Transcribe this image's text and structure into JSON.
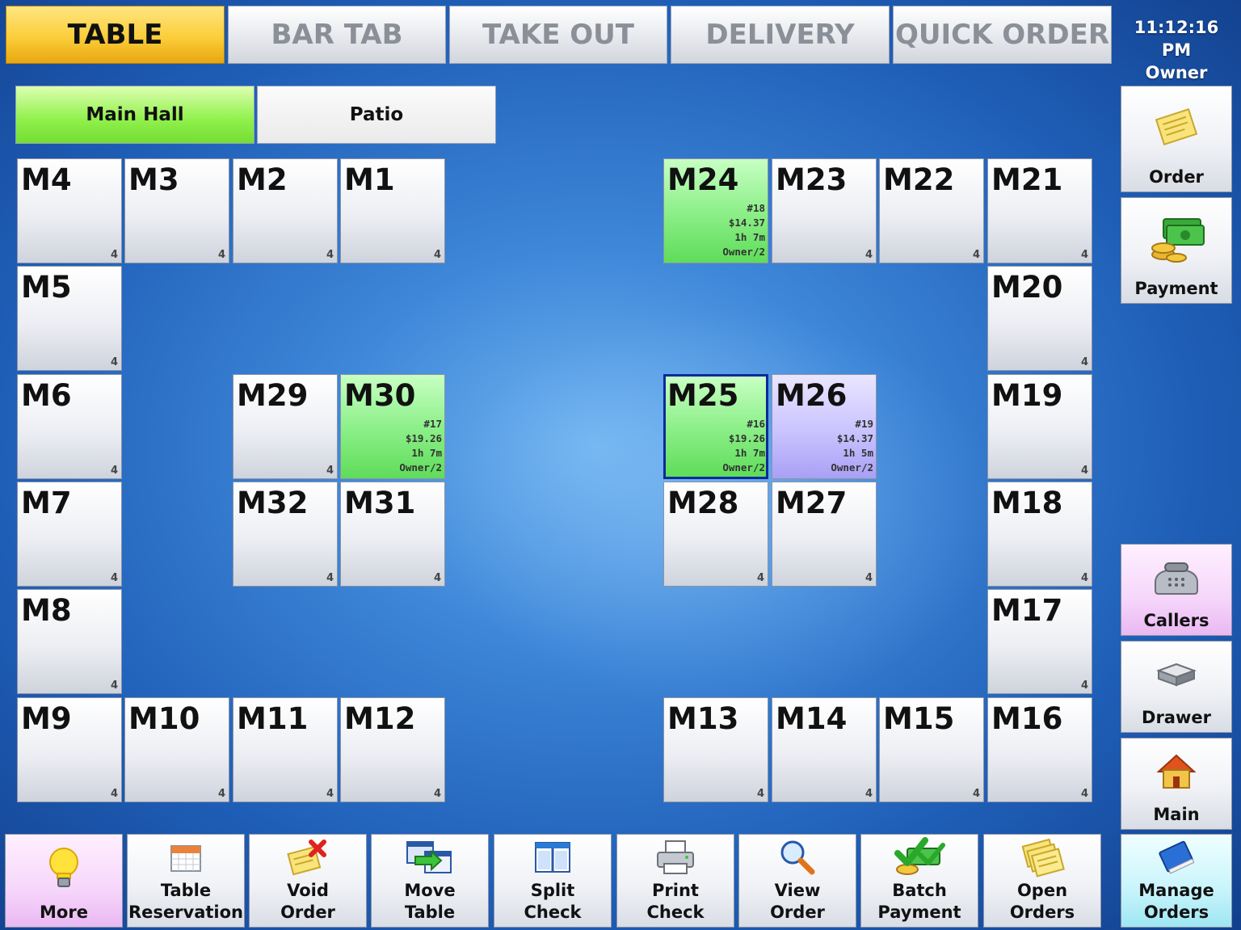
{
  "tabs": [
    "TABLE",
    "BAR TAB",
    "TAKE OUT",
    "DELIVERY",
    "QUICK ORDER"
  ],
  "clock": {
    "time": "11:12:16 PM",
    "user": "Owner"
  },
  "sections": [
    "Main Hall",
    "Patio"
  ],
  "tables": {
    "M1": {
      "name": "M1",
      "seats": "4"
    },
    "M2": {
      "name": "M2",
      "seats": "4"
    },
    "M3": {
      "name": "M3",
      "seats": "4"
    },
    "M4": {
      "name": "M4",
      "seats": "4"
    },
    "M5": {
      "name": "M5",
      "seats": "4"
    },
    "M6": {
      "name": "M6",
      "seats": "4"
    },
    "M7": {
      "name": "M7",
      "seats": "4"
    },
    "M8": {
      "name": "M8",
      "seats": "4"
    },
    "M9": {
      "name": "M9",
      "seats": "4"
    },
    "M10": {
      "name": "M10",
      "seats": "4"
    },
    "M11": {
      "name": "M11",
      "seats": "4"
    },
    "M12": {
      "name": "M12",
      "seats": "4"
    },
    "M13": {
      "name": "M13",
      "seats": "4"
    },
    "M14": {
      "name": "M14",
      "seats": "4"
    },
    "M15": {
      "name": "M15",
      "seats": "4"
    },
    "M16": {
      "name": "M16",
      "seats": "4"
    },
    "M17": {
      "name": "M17",
      "seats": "4"
    },
    "M18": {
      "name": "M18",
      "seats": "4"
    },
    "M19": {
      "name": "M19",
      "seats": "4"
    },
    "M20": {
      "name": "M20",
      "seats": "4"
    },
    "M21": {
      "name": "M21",
      "seats": "4"
    },
    "M22": {
      "name": "M22",
      "seats": "4"
    },
    "M23": {
      "name": "M23",
      "seats": "4"
    },
    "M24": {
      "name": "M24",
      "order": "#18",
      "amount": "$14.37",
      "time": "1h 7m",
      "server": "Owner/2"
    },
    "M25": {
      "name": "M25",
      "order": "#16",
      "amount": "$19.26",
      "time": "1h 7m",
      "server": "Owner/2"
    },
    "M26": {
      "name": "M26",
      "order": "#19",
      "amount": "$14.37",
      "time": "1h 5m",
      "server": "Owner/2"
    },
    "M27": {
      "name": "M27",
      "seats": "4"
    },
    "M28": {
      "name": "M28",
      "seats": "4"
    },
    "M29": {
      "name": "M29",
      "seats": "4"
    },
    "M30": {
      "name": "M30",
      "order": "#17",
      "amount": "$19.26",
      "time": "1h 7m",
      "server": "Owner/2"
    },
    "M31": {
      "name": "M31",
      "seats": "4"
    },
    "M32": {
      "name": "M32",
      "seats": "4"
    }
  },
  "right_buttons": {
    "order": "Order",
    "payment": "Payment",
    "callers": "Callers",
    "drawer": "Drawer",
    "main": "Main",
    "manage_orders": "Manage\nOrders"
  },
  "bottom_buttons": {
    "more": "More",
    "table_reservation": "Table\nReservation",
    "void_order": "Void\nOrder",
    "move_table": "Move\nTable",
    "split_check": "Split\nCheck",
    "print_check": "Print\nCheck",
    "view_order": "View\nOrder",
    "batch_payment": "Batch\nPayment",
    "open_orders": "Open\nOrders"
  },
  "icons": [
    "lightbulb-icon",
    "calendar-icon",
    "void-order-icon",
    "move-table-icon",
    "split-check-icon",
    "printer-icon",
    "magnifier-icon",
    "batch-payment-icon",
    "open-orders-icon",
    "notepad-icon",
    "cash-icon",
    "phone-icon",
    "drawer-icon",
    "home-icon",
    "book-icon"
  ],
  "colors": {
    "active_tab": "#fbcd3a",
    "active_section": "#8ff04a",
    "occupied_table": "#8ef08a",
    "selected_border": "#0a2a9a",
    "lavender_table": "#c9c3ff"
  }
}
